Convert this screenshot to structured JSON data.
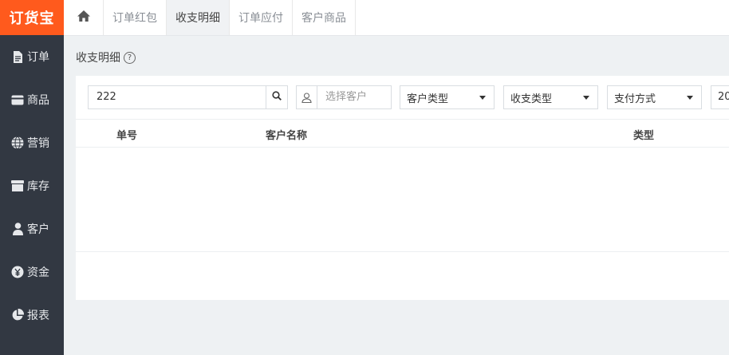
{
  "app": {
    "logo_text": "订货宝"
  },
  "sidebar": {
    "items": [
      {
        "label": "订单",
        "icon": "document-icon"
      },
      {
        "label": "商品",
        "icon": "card-icon"
      },
      {
        "label": "营销",
        "icon": "globe-icon"
      },
      {
        "label": "库存",
        "icon": "box-icon"
      },
      {
        "label": "客户",
        "icon": "user-icon"
      },
      {
        "label": "资金",
        "icon": "yen-icon"
      },
      {
        "label": "报表",
        "icon": "pie-chart-icon"
      }
    ]
  },
  "tabs": [
    {
      "label": "订单红包",
      "active": false
    },
    {
      "label": "收支明细",
      "active": true
    },
    {
      "label": "订单应付",
      "active": false
    },
    {
      "label": "客户商品",
      "active": false
    }
  ],
  "page": {
    "title": "收支明细",
    "help": "?"
  },
  "filters": {
    "search_value": "222",
    "customer_placeholder": "选择客户",
    "customer_type": "客户类型",
    "payment_type": "收支类型",
    "pay_method": "支付方式",
    "date_partial": "20"
  },
  "table": {
    "columns": [
      "单号",
      "客户名称",
      "类型"
    ]
  },
  "colors": {
    "accent": "#ff5a1d",
    "sidebar": "#323842"
  }
}
